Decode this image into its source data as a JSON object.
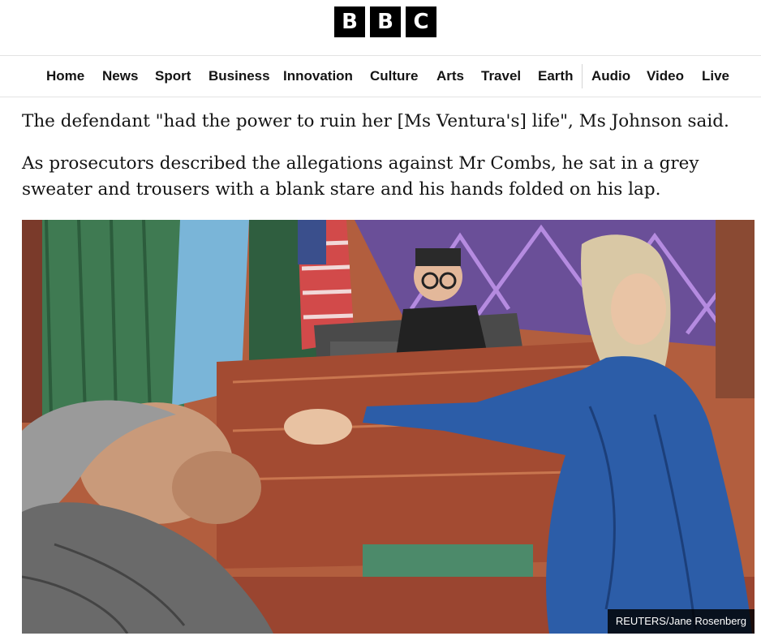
{
  "header": {
    "logo_letters": [
      "B",
      "B",
      "C"
    ]
  },
  "nav": {
    "items": [
      "Home",
      "News",
      "Sport",
      "Business",
      "Innovation",
      "Culture",
      "Arts",
      "Travel",
      "Earth",
      "Audio",
      "Video",
      "Live"
    ]
  },
  "article": {
    "paragraphs": [
      "The defendant \"had the power to ruin her [Ms Ventura's] life\", Ms Johnson said.",
      "As prosecutors described the allegations against Mr Combs, he sat in a grey sweater and trousers with a blank stare and his hands folded on his lap."
    ]
  },
  "figure": {
    "credit": "REUTERS/Jane Rosenberg"
  },
  "colors": {
    "logo_block": "#000000",
    "text": "#141414",
    "nav_border": "#e3e3e3"
  }
}
